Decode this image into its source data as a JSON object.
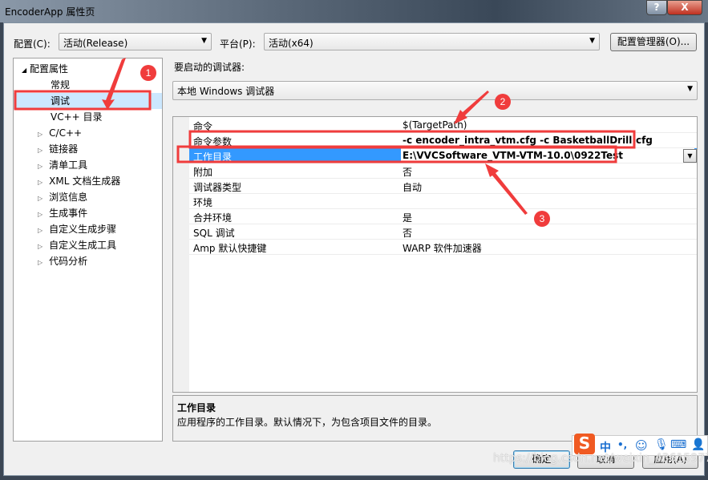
{
  "window": {
    "title": "EncoderApp 属性页",
    "help": "?",
    "close": "X"
  },
  "toolbar": {
    "config_label": "配置(C):",
    "config_value": "活动(Release)",
    "platform_label": "平台(P):",
    "platform_value": "活动(x64)",
    "config_manager": "配置管理器(O)..."
  },
  "tree": {
    "root": "配置属性",
    "items": [
      {
        "label": "常规",
        "expandable": false
      },
      {
        "label": "调试",
        "expandable": false,
        "selected": true
      },
      {
        "label": "VC++ 目录",
        "expandable": false
      },
      {
        "label": "C/C++",
        "expandable": true
      },
      {
        "label": "链接器",
        "expandable": true
      },
      {
        "label": "清单工具",
        "expandable": true
      },
      {
        "label": "XML 文档生成器",
        "expandable": true
      },
      {
        "label": "浏览信息",
        "expandable": true
      },
      {
        "label": "生成事件",
        "expandable": true
      },
      {
        "label": "自定义生成步骤",
        "expandable": true
      },
      {
        "label": "自定义生成工具",
        "expandable": true
      },
      {
        "label": "代码分析",
        "expandable": true
      }
    ]
  },
  "debugger": {
    "label": "要启动的调试器:",
    "value": "本地 Windows 调试器"
  },
  "properties": [
    {
      "key": "命令",
      "value": "$(TargetPath)"
    },
    {
      "key": "命令参数",
      "value": "-c encoder_intra_vtm.cfg -c BasketballDrill.cfg",
      "bold": true
    },
    {
      "key": "工作目录",
      "value": "E:\\VVCSoftware_VTM-VTM-10.0\\0922Test",
      "selected": true
    },
    {
      "key": "附加",
      "value": "否"
    },
    {
      "key": "调试器类型",
      "value": "自动"
    },
    {
      "key": "环境",
      "value": ""
    },
    {
      "key": "合并环境",
      "value": "是"
    },
    {
      "key": "SQL 调试",
      "value": "否"
    },
    {
      "key": "Amp 默认快捷键",
      "value": "WARP 软件加速器"
    }
  ],
  "description": {
    "title": "工作目录",
    "text": "应用程序的工作目录。默认情况下，为包含项目文件的目录。"
  },
  "buttons": {
    "ok": "确定",
    "cancel": "取消",
    "apply": "应用(A)"
  },
  "ime": {
    "logo": "S",
    "mode": "中",
    "punct": "•,"
  },
  "annotations": {
    "n1": "1",
    "n2": "2",
    "n3": "3",
    "color": "#f03c3c"
  },
  "watermark": "https://blog.csdn.net/weixin_43615977"
}
